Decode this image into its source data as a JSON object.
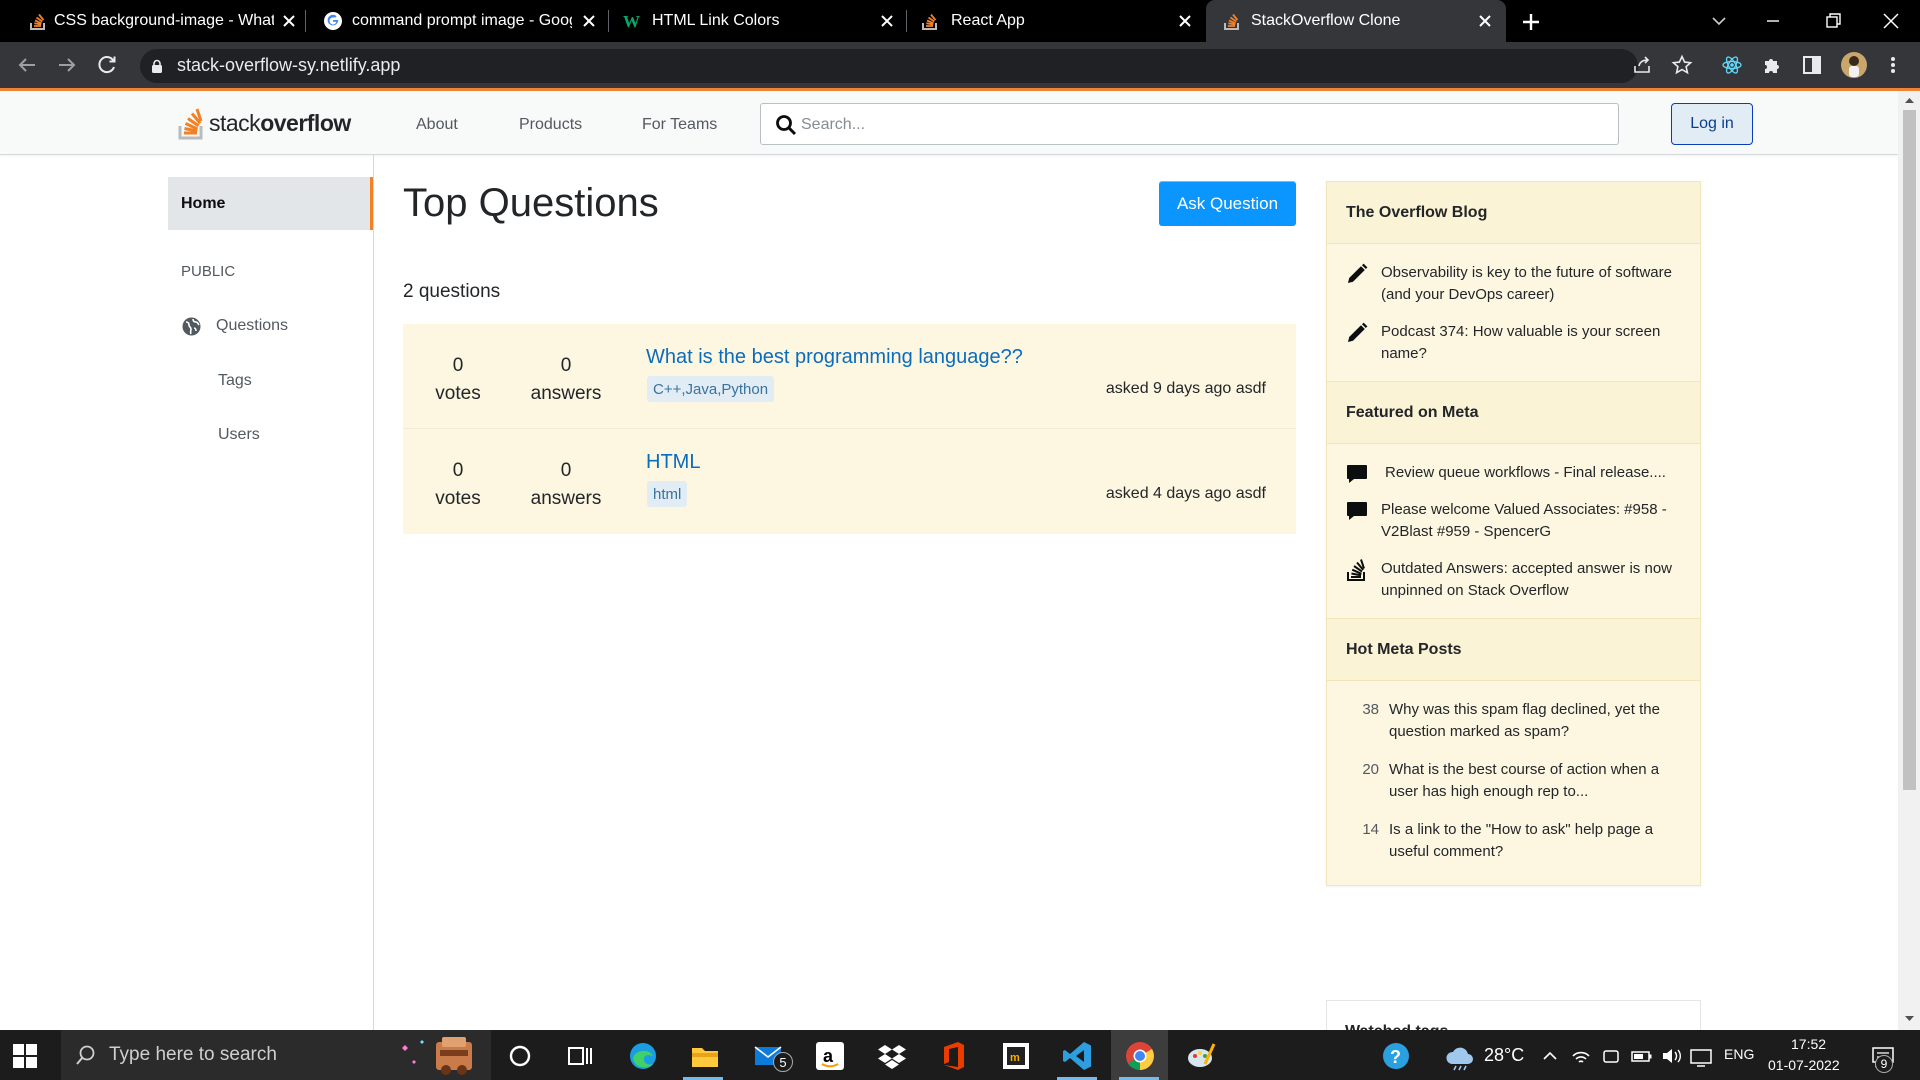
{
  "browser": {
    "tabs": [
      {
        "title": "CSS background-image - What is",
        "icon": "stackoverflow-favicon"
      },
      {
        "title": "command prompt image - Googl",
        "icon": "google-favicon"
      },
      {
        "title": "HTML Link Colors",
        "icon": "w3schools-favicon"
      },
      {
        "title": "React App",
        "icon": "stackoverflow-favicon"
      },
      {
        "title": "StackOverflow Clone",
        "icon": "stackoverflow-favicon",
        "active": true
      }
    ],
    "url": "stack-overflow-sy.netlify.app"
  },
  "site": {
    "logo": {
      "part1": "stack",
      "part2": "overflow"
    },
    "nav": {
      "about": "About",
      "products": "Products",
      "for_teams": "For Teams"
    },
    "search": {
      "placeholder": "Search...",
      "value": ""
    },
    "login_label": "Log in"
  },
  "sidebar": {
    "home": "Home",
    "public": "PUBLIC",
    "questions": "Questions",
    "tags": "Tags",
    "users": "Users"
  },
  "main": {
    "title": "Top Questions",
    "ask_button": "Ask Question",
    "count_text": "2 questions",
    "questions": [
      {
        "votes": "0",
        "votes_label": "votes",
        "answers": "0",
        "answers_label": "answers",
        "title": "What is the best programming language??",
        "tags": "C++,Java,Python",
        "asked": "asked 9 days ago asdf"
      },
      {
        "votes": "0",
        "votes_label": "votes",
        "answers": "0",
        "answers_label": "answers",
        "title": "HTML",
        "tags": "html",
        "asked": "asked 4 days ago asdf"
      }
    ]
  },
  "widgets": {
    "blog": {
      "heading": "The Overflow Blog",
      "items": [
        {
          "icon": "pencil-icon",
          "text": "Observability is key to the future of software (and your DevOps career)"
        },
        {
          "icon": "pencil-icon",
          "text": "Podcast 374: How valuable is your screen name?"
        }
      ]
    },
    "meta": {
      "heading": "Featured on Meta",
      "items": [
        {
          "icon": "comment-icon",
          "text": "Review queue workflows - Final release...."
        },
        {
          "icon": "comment-icon",
          "text": "Please welcome Valued Associates: #958 - V2Blast #959 - SpencerG"
        },
        {
          "icon": "stackoverflow-icon",
          "text": "Outdated Answers: accepted answer is now unpinned on Stack Overflow"
        }
      ]
    },
    "hot": {
      "heading": "Hot Meta Posts",
      "items": [
        {
          "count": "38",
          "text": "Why was this spam flag declined, yet the question marked as spam?"
        },
        {
          "count": "20",
          "text": "What is the best course of action when a user has high enough rep to..."
        },
        {
          "count": "14",
          "text": "Is a link to the \"How to ask\" help page a useful comment?"
        }
      ]
    },
    "watched": {
      "heading": "Watched tags"
    }
  },
  "taskbar": {
    "search_placeholder": "Type here to search",
    "mail_badge": "5",
    "temperature": "28°C",
    "language": "ENG",
    "time": "17:52",
    "date": "01-07-2022",
    "notification_badge": "9"
  },
  "colors": {
    "accent_orange": "#f48225",
    "ask_button": "#0a95ff",
    "link_blue": "#0a6cbd",
    "question_bg": "#fdf7e2",
    "widget_bg": "#fbf3d5"
  }
}
